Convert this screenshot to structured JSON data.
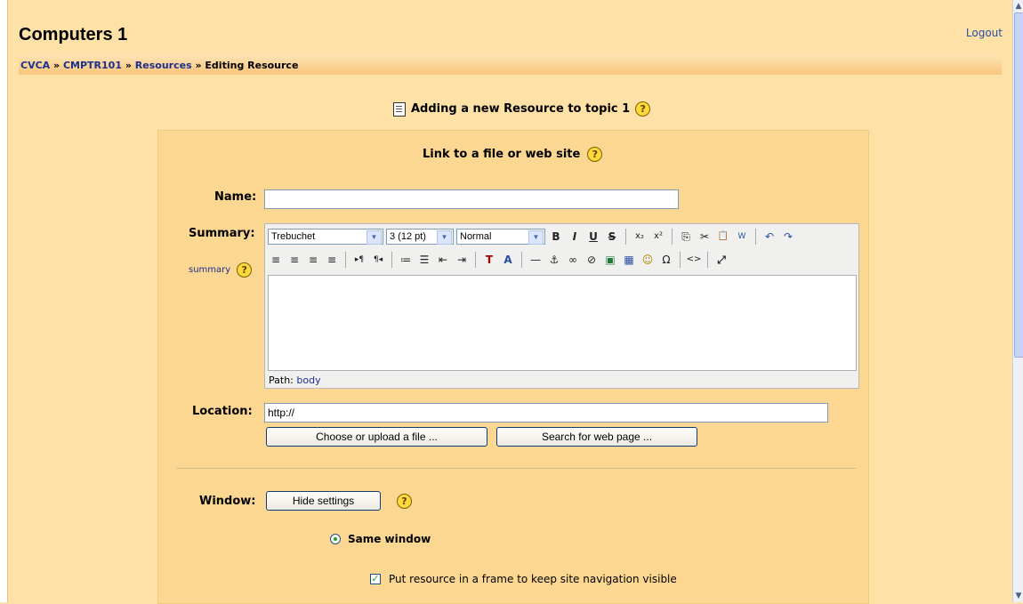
{
  "header": {
    "title": "Computers 1",
    "logout": "Logout",
    "breadcrumbs": [
      "CVCA",
      "CMPTR101",
      "Resources",
      "Editing Resource"
    ],
    "breadcrumb_separator": "»"
  },
  "page": {
    "heading": "Adding a new Resource to topic 1",
    "help_symbol": "?"
  },
  "form": {
    "title": "Link to a file or web site",
    "name_label": "Name:",
    "name_value": "",
    "summary_label": "Summary:",
    "summary_help_link": "summary",
    "location_label": "Location:",
    "location_value": "http://",
    "choose_file_button": "Choose or upload a file ...",
    "search_web_button": "Search for web page ...",
    "window_label": "Window:",
    "hide_settings_button": "Hide settings",
    "same_window_label": "Same window",
    "frame_checkbox_label": "Put resource in a frame to keep site navigation visible",
    "frame_checked": true,
    "same_window_selected": true
  },
  "editor": {
    "font_select": "Trebuchet",
    "size_select": "3 (12 pt)",
    "style_select": "Normal",
    "toolbar1_icons": [
      "bold-icon",
      "italic-icon",
      "underline-icon",
      "strikethrough-icon",
      "subscript-icon",
      "superscript-icon",
      "copy-icon",
      "cut-icon",
      "paste-icon",
      "paste-word-icon",
      "undo-icon",
      "redo-icon"
    ],
    "toolbar1_glyphs": [
      "B",
      "I",
      "U",
      "S",
      "x₂",
      "x²",
      "⎘",
      "✂",
      "📋",
      "W",
      "↶",
      "↷"
    ],
    "toolbar2_icons": [
      "align-left-icon",
      "align-center-icon",
      "align-right-icon",
      "justify-icon",
      "ltr-icon",
      "rtl-icon",
      "ordered-list-icon",
      "unordered-list-icon",
      "outdent-icon",
      "indent-icon",
      "text-color-icon",
      "background-color-icon",
      "horizontal-rule-icon",
      "anchor-icon",
      "link-icon",
      "unlink-icon",
      "image-icon",
      "table-icon",
      "smiley-icon",
      "special-char-icon",
      "html-source-icon",
      "fullscreen-icon"
    ],
    "toolbar2_glyphs": [
      "≡",
      "≡",
      "≡",
      "≡",
      "▸¶",
      "¶◂",
      "≔",
      "☰",
      "⇤",
      "⇥",
      "T",
      "A",
      "—",
      "⚓",
      "∞",
      "⊘",
      "▣",
      "▦",
      "☺",
      "Ω",
      "<>",
      "⤢"
    ],
    "path_label": "Path:",
    "path_value": "body"
  }
}
